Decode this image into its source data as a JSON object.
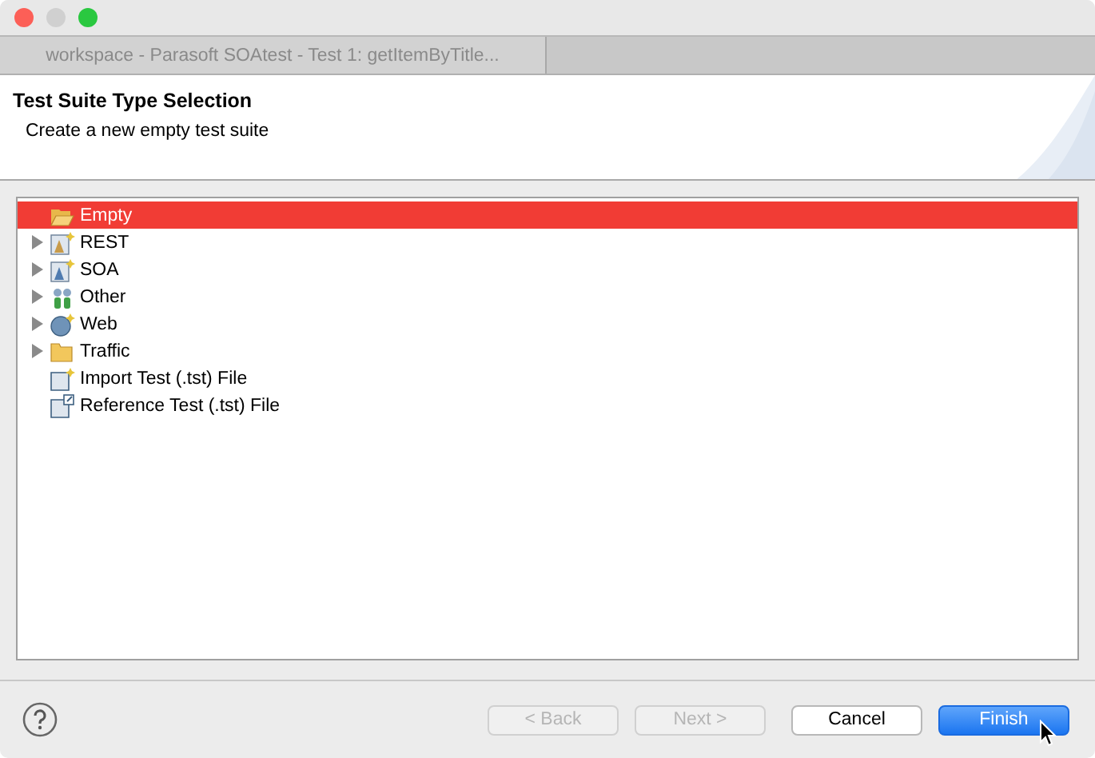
{
  "window": {
    "tab_title": "workspace - Parasoft SOAtest - Test 1: getItemByTitle..."
  },
  "header": {
    "title": "Test Suite Type Selection",
    "description": "Create a new empty test suite"
  },
  "tree": [
    {
      "label": "Empty",
      "kind": "open-folder",
      "expandable": false,
      "selected": true
    },
    {
      "label": "REST",
      "kind": "rest",
      "expandable": true,
      "selected": false
    },
    {
      "label": "SOA",
      "kind": "soa",
      "expandable": true,
      "selected": false
    },
    {
      "label": "Other",
      "kind": "other",
      "expandable": true,
      "selected": false
    },
    {
      "label": "Web",
      "kind": "web",
      "expandable": true,
      "selected": false
    },
    {
      "label": "Traffic",
      "kind": "folder",
      "expandable": true,
      "selected": false
    },
    {
      "label": "Import Test (.tst) File",
      "kind": "import",
      "expandable": false,
      "selected": false
    },
    {
      "label": "Reference Test (.tst) File",
      "kind": "reference",
      "expandable": false,
      "selected": false
    }
  ],
  "buttons": [
    {
      "label": "< Back",
      "disabled": true,
      "default": false
    },
    {
      "label": "Next >",
      "disabled": true,
      "default": false
    },
    {
      "label": "Cancel",
      "disabled": false,
      "default": false
    },
    {
      "label": "Finish",
      "disabled": false,
      "default": true
    }
  ]
}
